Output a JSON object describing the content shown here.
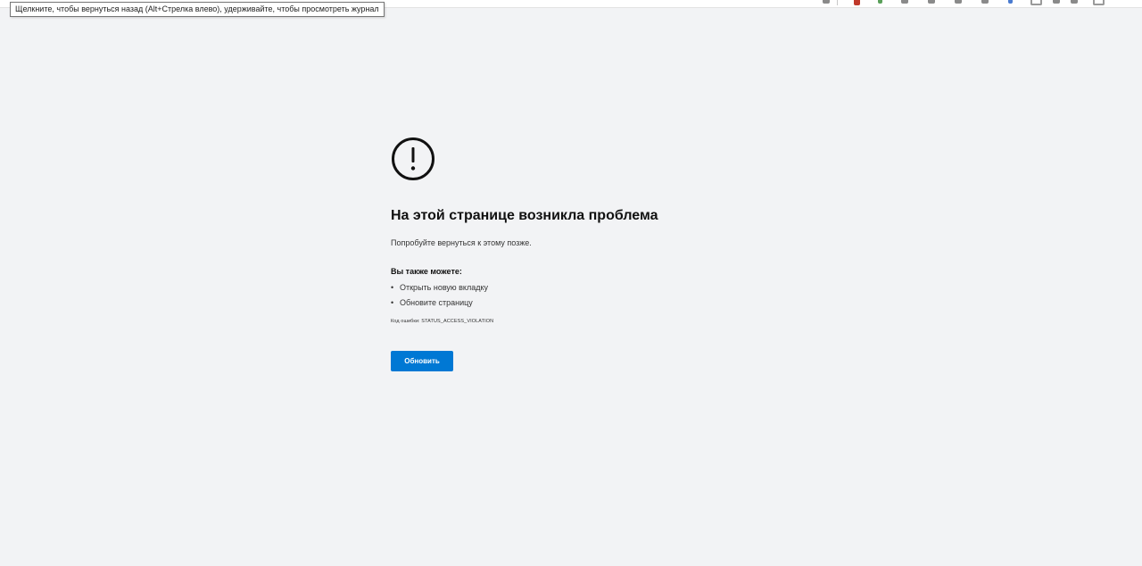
{
  "tooltip": {
    "text": "Щелкните, чтобы вернуться назад (Alt+Стрелка влево), удерживайте, чтобы просмотреть журнал"
  },
  "error": {
    "icon": "exclamation-circle-icon",
    "title": "На этой странице возникла проблема",
    "subtitle": "Попробуйте вернуться к этому позже.",
    "also_heading": "Вы также можете:",
    "actions": [
      "Открыть новую вкладку",
      "Обновите страницу"
    ],
    "error_code": "Код ошибки: STATUS_ACCESS_VIOLATION",
    "refresh_label": "Обновить"
  },
  "colors": {
    "background": "#f2f3f5",
    "button": "#0078d4",
    "button_text": "#ffffff"
  }
}
